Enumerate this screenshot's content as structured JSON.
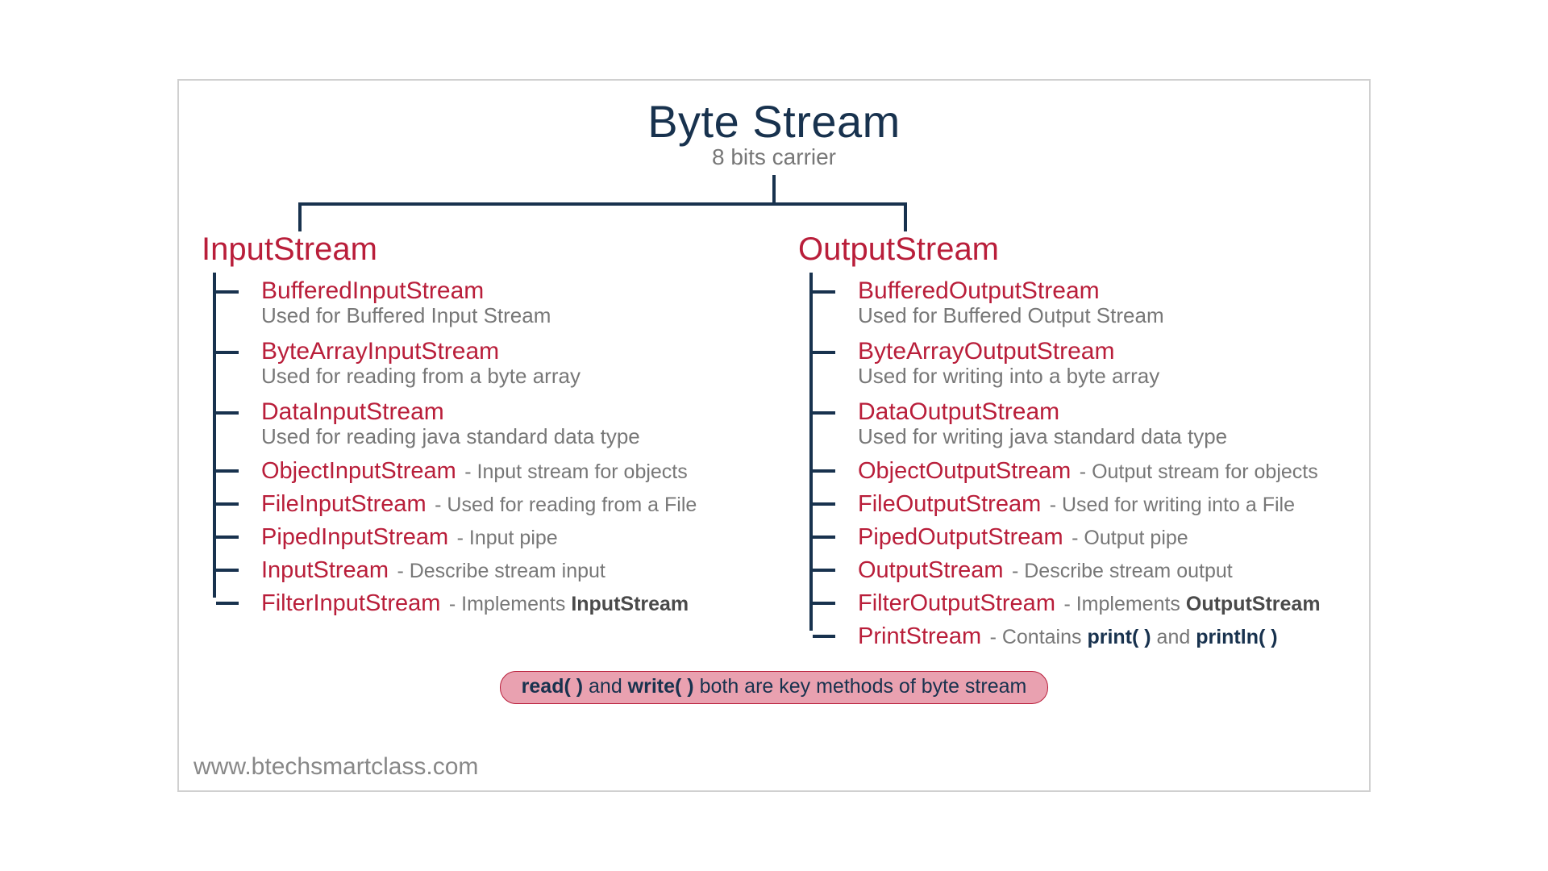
{
  "title": "Byte Stream",
  "subtitle": "8 bits carrier",
  "watermark": "www.btechsmartclass.com",
  "columns": {
    "input": {
      "heading": "InputStream",
      "items": [
        {
          "name": "BufferedInputStream",
          "desc": "Used for Buffered Input Stream",
          "inline": false
        },
        {
          "name": "ByteArrayInputStream",
          "desc": "Used for reading from a byte array",
          "inline": false
        },
        {
          "name": "DataInputStream",
          "desc": "Used for reading java standard data type",
          "inline": false
        },
        {
          "name": "ObjectInputStream",
          "desc": " - Input stream for objects",
          "inline": true
        },
        {
          "name": "FileInputStream",
          "desc": " - Used for reading from a File",
          "inline": true
        },
        {
          "name": "PipedInputStream",
          "desc": " - Input pipe",
          "inline": true
        },
        {
          "name": "InputStream",
          "desc": " - Describe stream input",
          "inline": true
        },
        {
          "name": "FilterInputStream",
          "desc": " - Implements ",
          "inline": true,
          "bold_suffix": "InputStream"
        }
      ]
    },
    "output": {
      "heading": "OutputStream",
      "items": [
        {
          "name": "BufferedOutputStream",
          "desc": "Used for Buffered Output Stream",
          "inline": false
        },
        {
          "name": "ByteArrayOutputStream",
          "desc": "Used for writing into a byte array",
          "inline": false
        },
        {
          "name": "DataOutputStream",
          "desc": "Used for writing java standard data type",
          "inline": false
        },
        {
          "name": "ObjectOutputStream",
          "desc": "- Output stream for objects",
          "inline": true
        },
        {
          "name": "FileOutputStream",
          "desc": "- Used for writing into a File",
          "inline": true
        },
        {
          "name": "PipedOutputStream",
          "desc": " - Output pipe",
          "inline": true
        },
        {
          "name": "OutputStream",
          "desc": "- Describe stream output",
          "inline": true
        },
        {
          "name": "FilterOutputStream",
          "desc": "- Implements ",
          "inline": true,
          "bold_suffix": "OutputStream"
        },
        {
          "name": "PrintStream",
          "desc": " - Contains ",
          "inline": true,
          "navy1": "print( )",
          "mid": " and ",
          "navy2": "println( )"
        }
      ]
    }
  },
  "pill": {
    "b1": "read( )",
    "mid1": " and ",
    "b2": "write( )",
    "rest": " both are key methods of byte stream"
  }
}
